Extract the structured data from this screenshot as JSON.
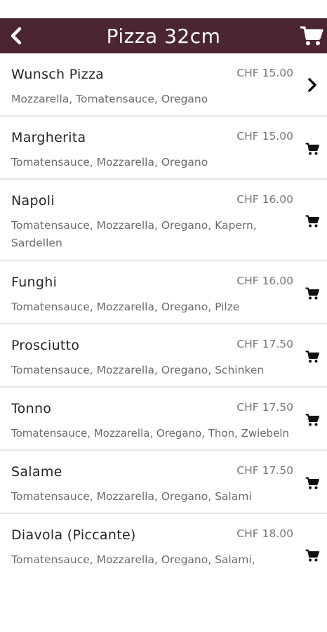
{
  "header": {
    "title": "Pizza 32cm",
    "back_icon": "chevron-left-icon",
    "cart_icon": "cart-icon",
    "bg_color": "#4b2630"
  },
  "items": [
    {
      "name": "Wunsch Pizza",
      "price": "CHF 15.00",
      "description": "Mozzarella, Tomatensauce, Oregano",
      "action_icon": "chevron-right-icon"
    },
    {
      "name": "Margherita",
      "price": "CHF 15.00",
      "description": "Tomatensauce, Mozzarella, Oregano",
      "action_icon": "cart-icon"
    },
    {
      "name": "Napoli",
      "price": "CHF 16.00",
      "description": "Tomatensauce, Mozzarella, Oregano, Kapern, Sardellen",
      "action_icon": "cart-icon"
    },
    {
      "name": "Funghi",
      "price": "CHF 16.00",
      "description": "Tomatensauce, Mozzarella, Oregano, Pilze",
      "action_icon": "cart-icon"
    },
    {
      "name": "Prosciutto",
      "price": "CHF 17.50",
      "description": "Tomatensauce, Mozzarella, Oregano, Schinken",
      "action_icon": "cart-icon"
    },
    {
      "name": "Tonno",
      "price": "CHF 17.50",
      "description": "Tomatensauce, Mozzarella, Oregano, Thon, Zwiebeln",
      "action_icon": "cart-icon"
    },
    {
      "name": "Salame",
      "price": "CHF 17.50",
      "description": "Tomatensauce, Mozzarella, Oregano, Salami",
      "action_icon": "cart-icon"
    },
    {
      "name": "Diavola (Piccante)",
      "price": "CHF 18.00",
      "description": "Tomatensauce, Mozzarella, Oregano, Salami,",
      "action_icon": "cart-icon"
    }
  ]
}
